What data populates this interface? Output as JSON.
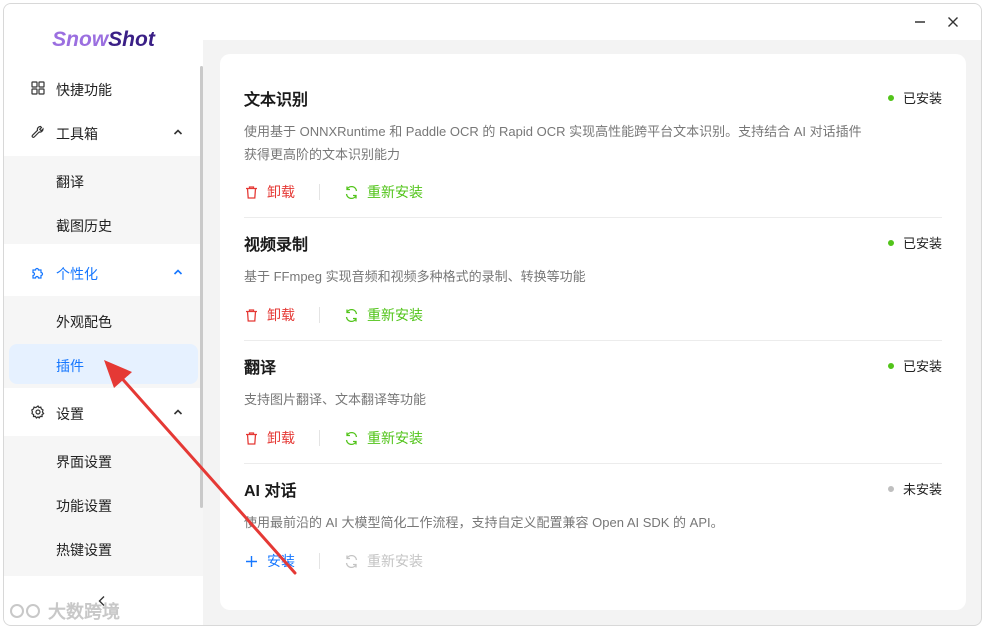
{
  "app": {
    "logo_part1": "Snow",
    "logo_part2": "Shot"
  },
  "sidebar": {
    "items": [
      {
        "label": "快捷功能",
        "icon": "grid-icon"
      },
      {
        "label": "工具箱",
        "icon": "wrench-icon"
      },
      {
        "label": "翻译"
      },
      {
        "label": "截图历史"
      },
      {
        "label": "个性化",
        "icon": "puzzle-icon"
      },
      {
        "label": "外观配色"
      },
      {
        "label": "插件"
      },
      {
        "label": "设置",
        "icon": "gear-icon"
      },
      {
        "label": "界面设置"
      },
      {
        "label": "功能设置"
      },
      {
        "label": "热键设置"
      }
    ],
    "collapse_icon": "chevron-left-icon"
  },
  "plugins": [
    {
      "title": "文本识别",
      "status": "已安装",
      "status_color": "#52c41a",
      "description": "使用基于 ONNXRuntime 和 Paddle OCR 的 Rapid OCR 实现高性能跨平台文本识别。支持结合 AI 对话插件获得更高阶的文本识别能力",
      "action1": "卸载",
      "action2": "重新安装"
    },
    {
      "title": "视频录制",
      "status": "已安装",
      "status_color": "#52c41a",
      "description": "基于 FFmpeg 实现音频和视频多种格式的录制、转换等功能",
      "action1": "卸载",
      "action2": "重新安装"
    },
    {
      "title": "翻译",
      "status": "已安装",
      "status_color": "#52c41a",
      "description": "支持图片翻译、文本翻译等功能",
      "action1": "卸载",
      "action2": "重新安装"
    },
    {
      "title": "AI 对话",
      "status": "未安装",
      "status_color": "#bfbfbf",
      "description": "使用最前沿的 AI 大模型简化工作流程，支持自定义配置兼容 Open AI SDK 的 API。",
      "action1": "安装",
      "action2": "重新安装"
    }
  ],
  "watermark": "大数跨境",
  "colors": {
    "accent": "#1677ff",
    "danger": "#e53935",
    "success": "#52c41a",
    "annotation_arrow": "#e53935"
  }
}
